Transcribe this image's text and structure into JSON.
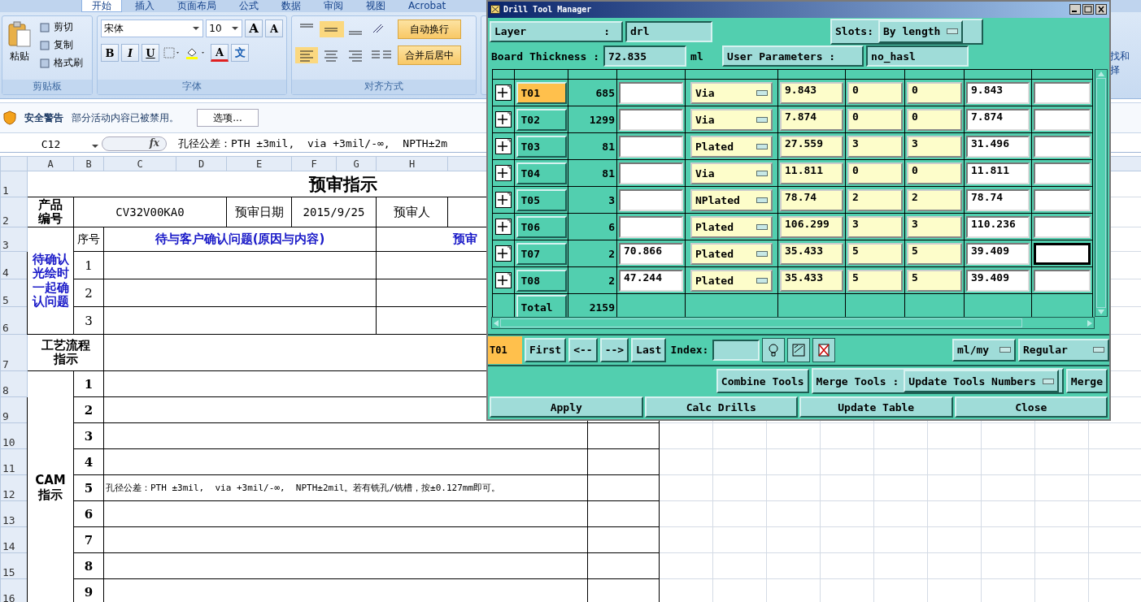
{
  "ribbon_tabs": [
    {
      "label": "开始",
      "selected": true
    },
    {
      "label": "插入",
      "selected": false
    },
    {
      "label": "页面布局",
      "selected": false
    },
    {
      "label": "公式",
      "selected": false
    },
    {
      "label": "数据",
      "selected": false
    },
    {
      "label": "审阅",
      "selected": false
    },
    {
      "label": "视图",
      "selected": false
    },
    {
      "label": "Acrobat",
      "selected": false
    }
  ],
  "clipboard": {
    "paste": "粘贴",
    "items": [
      "剪切",
      "复制",
      "格式刷"
    ],
    "title": "剪贴板"
  },
  "font": {
    "name": "宋体",
    "size": "10",
    "grow": "A",
    "shrink": "A",
    "styles": [
      "B",
      "I",
      "U"
    ],
    "color_letter": "A",
    "phonetic": "文",
    "title": "字体"
  },
  "alignment": {
    "wrap": "自动换行",
    "merge": "合并后居中",
    "title": "对齐方式"
  },
  "ribbon_edge": [
    "找和",
    "择"
  ],
  "security": {
    "title": "安全警告",
    "message": "部分活动内容已被禁用。",
    "button": "选项..."
  },
  "formula_bar": {
    "name_box": "C12",
    "function_label": "fx",
    "formula": "孔径公差：PTH ±3mil,  via +3mil/-∞,  NPTH±2m"
  },
  "sheet": {
    "columns": [
      "A",
      "B",
      "C",
      "D",
      "E",
      "F",
      "G",
      "H"
    ],
    "rows": [
      "1",
      "2",
      "3",
      "4",
      "5",
      "6",
      "7",
      "8",
      "9",
      "10",
      "11",
      "12",
      "13",
      "14",
      "15",
      "16"
    ],
    "title": "预审指示",
    "product_label": "产品编号",
    "product_no": "CV32V00KA0",
    "date_label": "预审日期",
    "date": "2015/9/25",
    "reviewer_label": "预审人",
    "confirm_label": "待确认光绘时一起确认问题",
    "seq_header": "序号",
    "question_header": "待与客户确认问题(原因与内容)",
    "opinion_header": "预审",
    "confirm_rows": [
      "1",
      "2",
      "3"
    ],
    "process_label": "工艺流程指示",
    "cam_label": "CAM指示",
    "cam_rows": [
      {
        "no": "1"
      },
      {
        "no": "2"
      },
      {
        "no": "3"
      },
      {
        "no": "4"
      },
      {
        "no": "5",
        "text": "孔径公差：PTH ±3mil,  via +3mil/-∞,  NPTH±2mil。若有铣孔/铣槽，按±0.127mm即可。"
      },
      {
        "no": "6"
      },
      {
        "no": "7"
      },
      {
        "no": "8"
      },
      {
        "no": "9"
      }
    ]
  },
  "dialog": {
    "title": "Drill Tool Manager",
    "layer_label": "Layer",
    "layer_colon": ":",
    "layer": "drl",
    "slots_label": "Slots:",
    "slots": "By length",
    "thickness_label": "Board Thickness :",
    "thickness": "72.835",
    "thickness_unit": "ml",
    "user_params_label": "User Parameters :",
    "user_params": "no_hasl",
    "tools": [
      {
        "name": "T01",
        "selected": true,
        "count": "685",
        "type": "Via",
        "size": "9.843",
        "tol_plus": "0",
        "tol_minus": "0",
        "finish": "9.843",
        "focused": false
      },
      {
        "name": "T02",
        "selected": false,
        "count": "1299",
        "type": "Via",
        "size": "7.874",
        "tol_plus": "0",
        "tol_minus": "0",
        "finish": "7.874",
        "focused": false
      },
      {
        "name": "T03",
        "selected": false,
        "count": "81",
        "type": "Plated",
        "size": "27.559",
        "tol_plus": "3",
        "tol_minus": "3",
        "finish": "31.496",
        "focused": false
      },
      {
        "name": "T04",
        "selected": false,
        "count": "81",
        "type": "Via",
        "size": "11.811",
        "tol_plus": "0",
        "tol_minus": "0",
        "finish": "11.811",
        "focused": false
      },
      {
        "name": "T05",
        "selected": false,
        "count": "3",
        "type": "NPlated",
        "size": "78.74",
        "tol_plus": "2",
        "tol_minus": "2",
        "finish": "78.74",
        "focused": false
      },
      {
        "name": "T06",
        "selected": false,
        "count": "6",
        "type": "Plated",
        "size": "106.299",
        "tol_plus": "3",
        "tol_minus": "3",
        "finish": "110.236",
        "focused": false
      },
      {
        "name": "T07",
        "selected": false,
        "count": "2",
        "length": "70.866",
        "type": "Plated",
        "size": "35.433",
        "tol_plus": "5",
        "tol_minus": "5",
        "finish": "39.409",
        "focused": true
      },
      {
        "name": "T08",
        "selected": false,
        "count": "2",
        "length": "47.244",
        "type": "Plated",
        "size": "35.433",
        "tol_plus": "5",
        "tol_minus": "5",
        "finish": "39.409",
        "focused": false
      }
    ],
    "total_label": "Total",
    "total_count": "2159",
    "current_tool": "T01",
    "nav_buttons": [
      "First",
      "<--",
      "-->",
      "Last"
    ],
    "index_label": "Index:",
    "units": "ml/my",
    "mode": "Regular",
    "combine": "Combine Tools",
    "merge_label": "Merge Tools :",
    "merge_option": "Update Tools Numbers",
    "merge_button": "Merge",
    "actions": [
      "Apply",
      "Calc Drills",
      "Update Table",
      "Close"
    ]
  }
}
